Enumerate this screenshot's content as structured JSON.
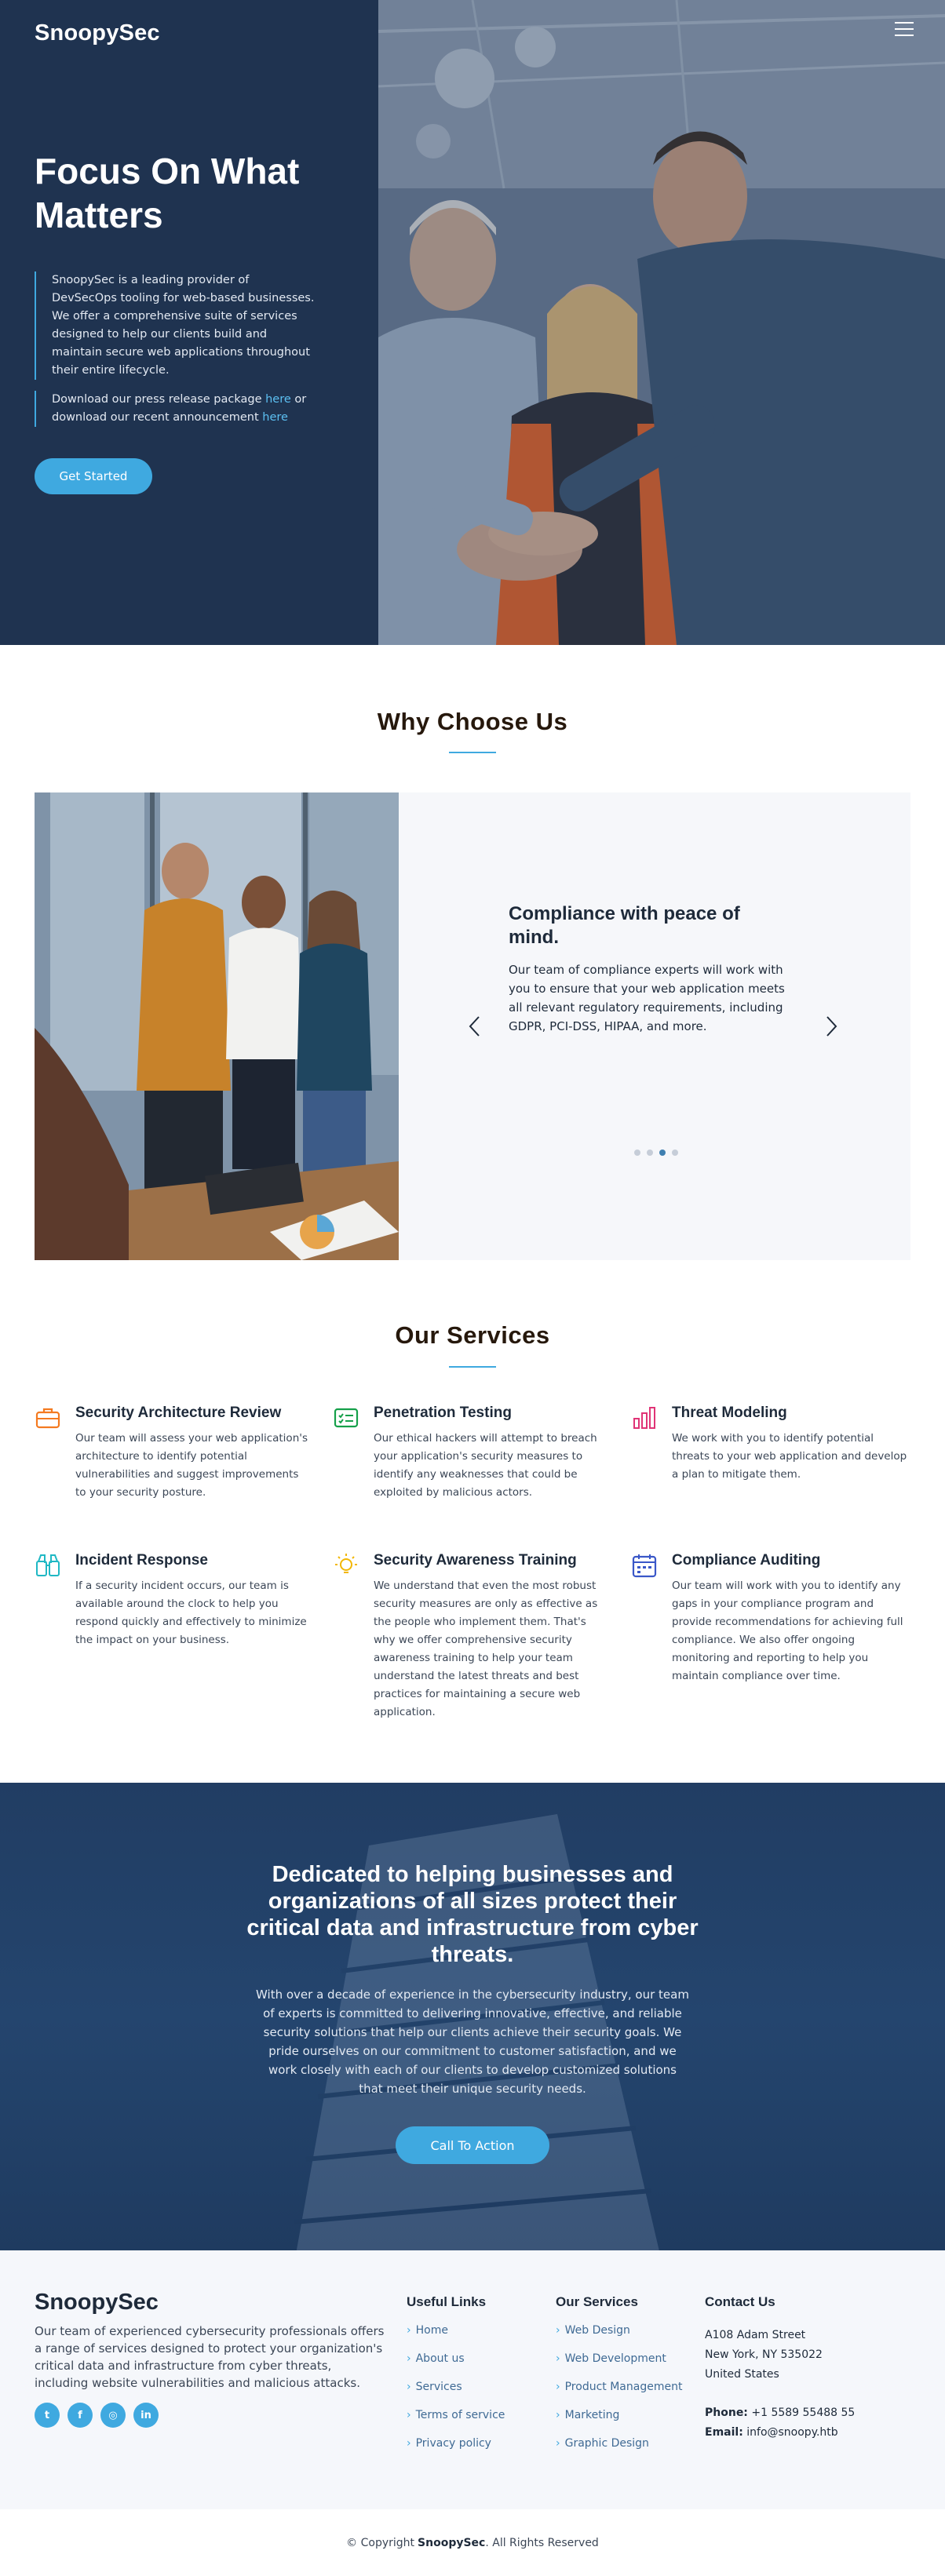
{
  "header": {
    "logo": "SnoopySec",
    "menu_icon": "hamburger-icon"
  },
  "hero": {
    "title": "Focus On What Matters",
    "para1": "SnoopySec is a leading provider of DevSecOps tooling for web-based businesses. We offer a comprehensive suite of services designed to help our clients build and maintain secure web applications throughout their entire lifecycle.",
    "para2_prefix": "Download our press release package ",
    "para2_link1": "here",
    "para2_middle": " or download our recent announcement ",
    "para2_link2": "here",
    "cta_label": "Get Started"
  },
  "why": {
    "title": "Why Choose Us",
    "slide_title": "Compliance with peace of mind.",
    "slide_text": "Our team of compliance experts will work with you to ensure that your web application meets all relevant regulatory requirements, including GDPR, PCI-DSS, HIPAA, and more.",
    "prev_icon": "chevron-left-icon",
    "next_icon": "chevron-right-icon",
    "slides_total": 4,
    "active_slide": 3
  },
  "services": {
    "title": "Our Services",
    "items": [
      {
        "title": "Security Architecture Review",
        "text": "Our team will assess your web application's architecture to identify potential vulnerabilities and suggest improvements to your security posture.",
        "icon": "briefcase-icon",
        "color": "#f47a20"
      },
      {
        "title": "Penetration Testing",
        "text": "Our ethical hackers will attempt to breach your application's security measures to identify any weaknesses that could be exploited by malicious actors.",
        "icon": "card-checklist-icon",
        "color": "#15a04a"
      },
      {
        "title": "Threat Modeling",
        "text": "We work with you to identify potential threats to your web application and develop a plan to mitigate them.",
        "icon": "bar-chart-icon",
        "color": "#e03476"
      },
      {
        "title": "Incident Response",
        "text": "If a security incident occurs, our team is available around the clock to help you respond quickly and effectively to minimize the impact on your business.",
        "icon": "binoculars-icon",
        "color": "#1fb8c4"
      },
      {
        "title": "Security Awareness Training",
        "text": "We understand that even the most robust security measures are only as effective as the people who implement them. That's why we offer comprehensive security awareness training to help your team understand the latest threats and best practices for maintaining a secure web application.",
        "icon": "lightbulb-icon",
        "color": "#f2b705"
      },
      {
        "title": "Compliance Auditing",
        "text": "Our team will work with you to identify any gaps in your compliance program and provide recommendations for achieving full compliance. We also offer ongoing monitoring and reporting to help you maintain compliance over time.",
        "icon": "calendar-icon",
        "color": "#3a57c8"
      }
    ]
  },
  "cta": {
    "title": "Dedicated to helping businesses and organizations of all sizes protect their critical data and infrastructure from cyber threats.",
    "text": "With over a decade of experience in the cybersecurity industry, our team of experts is committed to delivering innovative, effective, and reliable security solutions that help our clients achieve their security goals. We pride ourselves on our commitment to customer satisfaction, and we work closely with each of our clients to develop customized solutions that meet their unique security needs.",
    "button": "Call To Action"
  },
  "footer": {
    "logo": "SnoopySec",
    "about": "Our team of experienced cybersecurity professionals offers a range of services designed to protect your organization's critical data and infrastructure from cyber threats, including website vulnerabilities and malicious attacks.",
    "socials": [
      {
        "icon": "twitter-icon",
        "glyph": "t"
      },
      {
        "icon": "facebook-icon",
        "glyph": "f"
      },
      {
        "icon": "instagram-icon",
        "glyph": "◎"
      },
      {
        "icon": "linkedin-icon",
        "glyph": "in"
      }
    ],
    "useful_links": {
      "title": "Useful Links",
      "items": [
        "Home",
        "About us",
        "Services",
        "Terms of service",
        "Privacy policy"
      ]
    },
    "our_services": {
      "title": "Our Services",
      "items": [
        "Web Design",
        "Web Development",
        "Product Management",
        "Marketing",
        "Graphic Design"
      ]
    },
    "contact": {
      "title": "Contact Us",
      "address1": "A108 Adam Street",
      "address2": "New York, NY 535022",
      "address3": "United States",
      "phone_label": "Phone:",
      "phone": "+1 5589 55488 55",
      "email_label": "Email:",
      "email": "info@snoopy.htb"
    },
    "copyright_prefix": "© Copyright",
    "copyright_brand": "SnoopySec",
    "copyright_suffix": ". All Rights Reserved"
  },
  "colors": {
    "navy": "#1f3350",
    "accent": "#3fa9e0",
    "cta_bg": "#23426a",
    "footer_bg": "#f5f7fb"
  }
}
